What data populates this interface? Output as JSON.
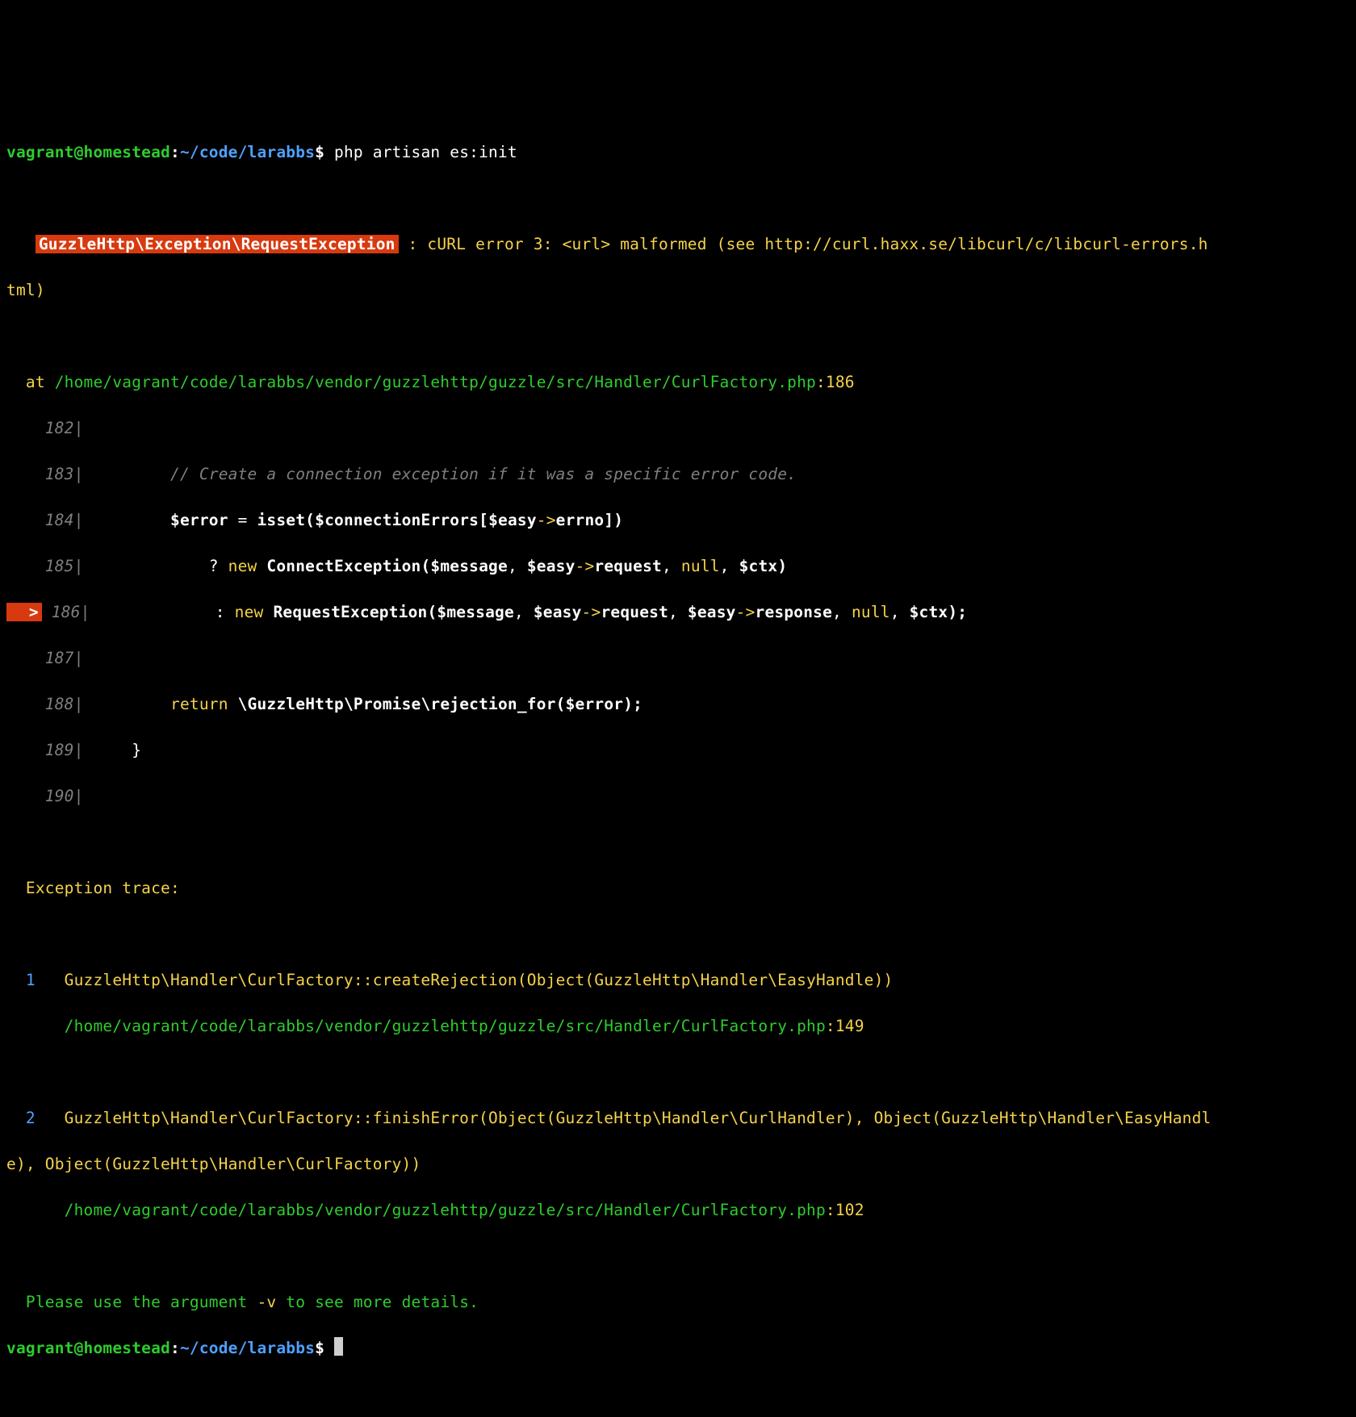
{
  "prompt1": {
    "user": "vagrant@homestead",
    "colon": ":",
    "path": "~/code/larabbs",
    "dollar": "$",
    "cmd": " php artisan es:init"
  },
  "blank": " ",
  "exc": {
    "lead1": "   ",
    "class": "GuzzleHttp\\Exception\\RequestException",
    "msgA": " : cURL error 3: <url> malformed (see http://curl.haxx.se/libcurl/c/libcurl-errors.h",
    "msgB": "tml)"
  },
  "at": {
    "label": "  at ",
    "path": "/home/vagrant/code/larabbs/vendor/guzzlehttp/guzzle/src/Handler/CurlFactory.php",
    "colon": ":",
    "line": "186"
  },
  "code": {
    "l182": {
      "prefix": "    ",
      "num": "182",
      "bar": "|",
      "body": ""
    },
    "l183": {
      "prefix": "    ",
      "num": "183",
      "bar": "|",
      "body": "         // Create a connection exception if it was a specific error code."
    },
    "l184": {
      "prefix": "    ",
      "num": "184",
      "bar": "|",
      "pre": "         ",
      "var1": "$error",
      "eq": " = ",
      "fn": "isset(",
      "var2": "$connectionErrors",
      "br": "[",
      "var3": "$easy",
      "arrow": "->",
      "prop": "errno",
      "close": "])"
    },
    "l185": {
      "prefix": "    ",
      "num": "185",
      "bar": "|",
      "pre": "             ? ",
      "kw": "new ",
      "cls": "ConnectException(",
      "var1": "$message",
      "c1": ", ",
      "var2": "$easy",
      "ar": "->",
      "prop": "request",
      "c2": ", ",
      "n": "null",
      "c3": ", ",
      "var3": "$ctx",
      "end": ")"
    },
    "l186": {
      "ptr": "  >",
      "sp": " ",
      "num": "186",
      "bar": "|",
      "pre": "             : ",
      "kw": "new ",
      "cls": "RequestException(",
      "var1": "$message",
      "c1": ", ",
      "var2": "$easy",
      "ar1": "->",
      "prop1": "request",
      "c2": ", ",
      "var3": "$easy",
      "ar2": "->",
      "prop2": "response",
      "c3": ", ",
      "n": "null",
      "c4": ", ",
      "var4": "$ctx",
      "end": ");"
    },
    "l187": {
      "prefix": "    ",
      "num": "187",
      "bar": "|",
      "body": ""
    },
    "l188": {
      "prefix": "    ",
      "num": "188",
      "bar": "|",
      "pre": "         ",
      "ret": "return ",
      "ns": "\\GuzzleHttp\\Promise\\rejection_for(",
      "var": "$error",
      "end": ");"
    },
    "l189": {
      "prefix": "    ",
      "num": "189",
      "bar": "|",
      "body": "     }"
    },
    "l190": {
      "prefix": "    ",
      "num": "190",
      "bar": "|",
      "body": ""
    }
  },
  "traceHeader": "  Exception trace:",
  "trace1": {
    "idx": "  1   ",
    "call": "GuzzleHttp\\Handler\\CurlFactory::createRejection(Object(GuzzleHttp\\Handler\\EasyHandle))",
    "pathPre": "      ",
    "path": "/home/vagrant/code/larabbs/vendor/guzzlehttp/guzzle/src/Handler/CurlFactory.php",
    "colon": ":",
    "line": "149"
  },
  "trace2": {
    "idx": "  2   ",
    "callA": "GuzzleHttp\\Handler\\CurlFactory::finishError(Object(GuzzleHttp\\Handler\\CurlHandler), Object(GuzzleHttp\\Handler\\EasyHandl",
    "callB": "e), Object(GuzzleHttp\\Handler\\CurlFactory))",
    "pathPre": "      ",
    "path": "/home/vagrant/code/larabbs/vendor/guzzlehttp/guzzle/src/Handler/CurlFactory.php",
    "colon": ":",
    "line": "102"
  },
  "hint": {
    "a": "  Please use the argument ",
    "flag": "-v",
    "b": " to see more details."
  },
  "prompt2": {
    "user": "vagrant@homestead",
    "colon": ":",
    "path": "~/code/larabbs",
    "dollar": "$"
  }
}
